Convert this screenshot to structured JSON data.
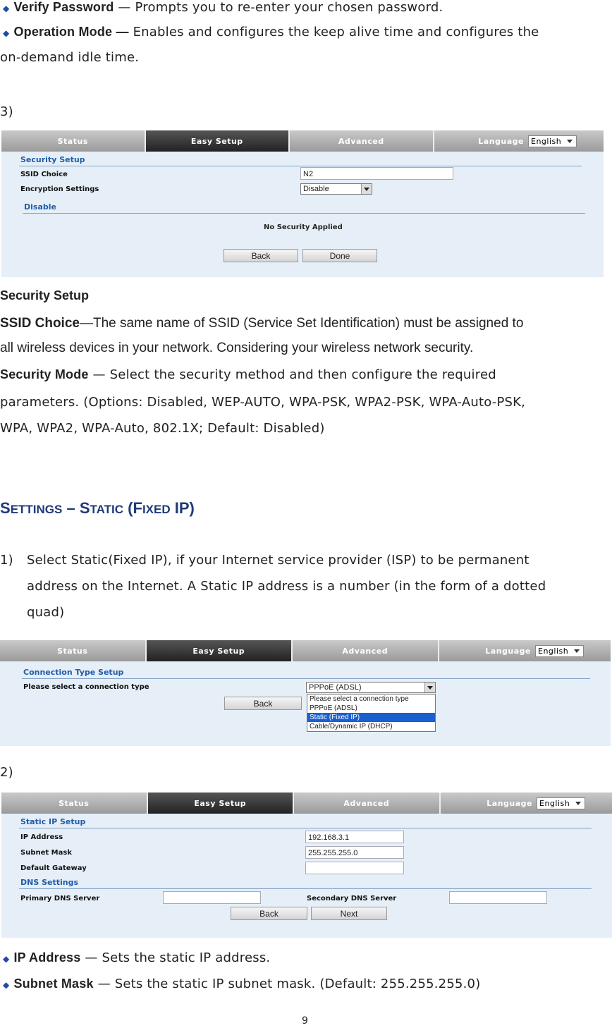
{
  "intro": {
    "verify_label": "Verify Password",
    "verify_text": " — Prompts you to re-enter your chosen password.",
    "opmode_label": "Operation Mode —",
    "opmode_text1": " Enables and configures the keep alive time and configures the",
    "opmode_text2": "on-demand idle time."
  },
  "step3_label": "3)",
  "shot1": {
    "tabs": [
      "Status",
      "Easy Setup",
      "Advanced"
    ],
    "language_label": "Language",
    "language_value": "English",
    "section": "Security Setup",
    "ssid_label": "SSID Choice",
    "ssid_value": "N2",
    "enc_label": "Encryption Settings",
    "enc_value": "Disable",
    "disable_title": "Disable",
    "no_security": "No Security Applied",
    "back": "Back",
    "done": "Done"
  },
  "security": {
    "heading": "Security Setup",
    "ssid_label": "SSID Choice",
    "ssid_text1": "—The same name of SSID (Service Set Identification) must be assigned to",
    "ssid_text2": "all wireless devices in your network. Considering your wireless network security.",
    "mode_label": "Security Mode",
    "mode_text1": " — Select the security method and then configure the required",
    "mode_text2": "parameters. (Options: Disabled, WEP-AUTO, WPA-PSK, WPA2-PSK, WPA-Auto-PSK,",
    "mode_text3": "WPA, WPA2, WPA-Auto, 802.1X; Default: Disabled)"
  },
  "settings_heading": {
    "s1": "S",
    "s2": "ETTINGS",
    "s3": " – ",
    "s4": "S",
    "s5": "TATIC",
    "s6": " (",
    "s7": "F",
    "s8": "IXED",
    "s9": " IP)"
  },
  "step1": {
    "num": "1)",
    "line1": "Select Static(Fixed IP), if your Internet service provider (ISP) to be permanent",
    "line2": "address on the Internet. A Static IP address is a number (in the form of a dotted",
    "line3": "quad)"
  },
  "shot2": {
    "tabs": [
      "Status",
      "Easy Setup",
      "Advanced"
    ],
    "language_label": "Language",
    "language_value": "English",
    "section": "Connection Type Setup",
    "conn_label": "Please select a connection type",
    "conn_value": "PPPoE (ADSL)",
    "options": [
      "Please select a connection type",
      "PPPoE (ADSL)",
      "Static (Fixed IP)",
      "Cable/Dynamic IP (DHCP)"
    ],
    "back": "Back"
  },
  "step2_label": "2)",
  "shot3": {
    "tabs": [
      "Status",
      "Easy Setup",
      "Advanced"
    ],
    "language_label": "Language",
    "language_value": "English",
    "section": "Static IP Setup",
    "ip_label": "IP Address",
    "ip_value": "192.168.3.1",
    "mask_label": "Subnet Mask",
    "mask_value": "255.255.255.0",
    "gw_label": "Default Gateway",
    "dns_title": "DNS Settings",
    "dns1_label": "Primary DNS Server",
    "dns2_label": "Secondary DNS Server",
    "back": "Back",
    "next": "Next"
  },
  "bullets": {
    "ip_label": "IP Address",
    "ip_text": " — Sets the static IP address.",
    "mask_label": "Subnet Mask",
    "mask_text": " — Sets the static IP subnet mask. (Default: 255.255.255.0)"
  },
  "page_number": "9",
  "colors": {
    "accent": "#1f5ca8",
    "heading": "#1f3a78",
    "panel_bg": "#e6eff8"
  }
}
